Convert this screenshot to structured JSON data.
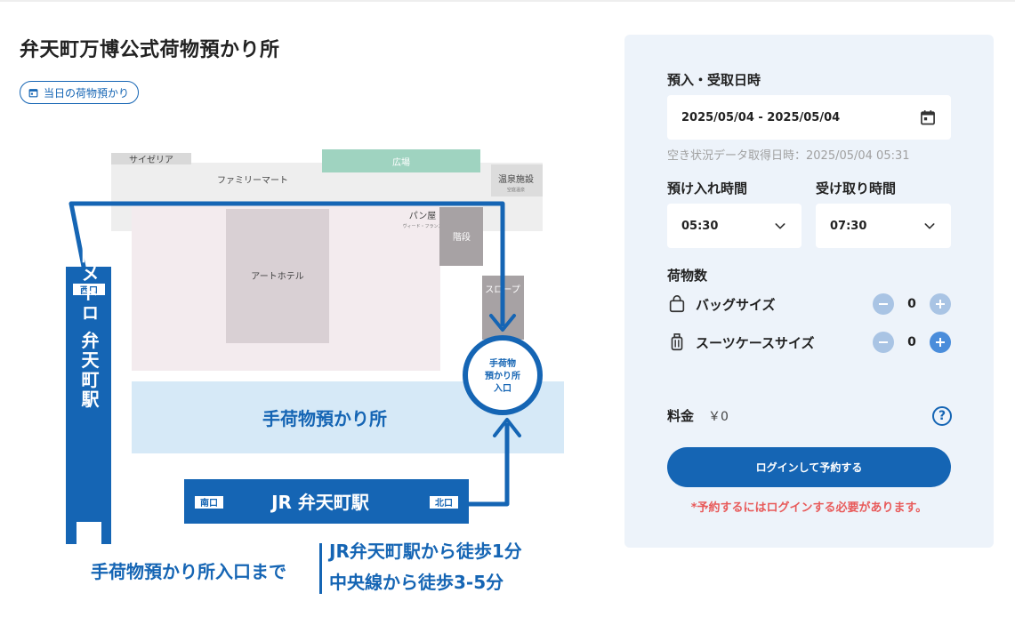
{
  "page": {
    "title": "弁天町万博公式荷物預かり所",
    "tag_label": "当日の荷物預かり"
  },
  "map": {
    "labels": {
      "saizeriya": "サイゼリア",
      "square": "広場",
      "family_mart": "ファミリーマート",
      "onsen": "温泉施設",
      "onsen_sub": "空庭温泉",
      "bakery": "パン屋",
      "bakery_sub": "ヴィード・フランス",
      "stairs": "階段",
      "art_hotel": "アートホテル",
      "slope": "スロープ",
      "west_exit": "西口",
      "metro": "大阪メトロ 弁天町駅",
      "entrance_line1": "手荷物",
      "entrance_line2": "預かり所",
      "entrance_line3": "入口",
      "storage": "手荷物預かり所",
      "south_exit": "南口",
      "jr_station": "JR 弁天町駅",
      "north_exit": "北口",
      "to_entrance": "手荷物預かり所入口まで",
      "walk_jr": "JR弁天町駅から徒歩1分",
      "walk_chuo": "中央線から徒歩3-5分"
    }
  },
  "booking": {
    "datetime_label": "預入・受取日時",
    "date_range": "2025/05/04 - 2025/05/04",
    "availability_note": "空き状況データ取得日時：2025/05/04 05:31",
    "dropoff_label": "預け入れ時間",
    "dropoff_value": "05:30",
    "pickup_label": "受け取り時間",
    "pickup_value": "07:30",
    "count_label": "荷物数",
    "items": [
      {
        "name": "バッグサイズ",
        "qty": "0",
        "icon": "bag-icon"
      },
      {
        "name": "スーツケースサイズ",
        "qty": "0",
        "icon": "suitcase-icon"
      }
    ],
    "fee_label": "料金",
    "fee_value": "￥0",
    "help_symbol": "?",
    "login_button": "ログインして予約する",
    "login_note": "*予約するにはログインする必要があります。"
  },
  "colors": {
    "brand": "#1565b4",
    "panel_bg": "#edf3fa",
    "warning": "#e85a5a",
    "square_green": "#9fd3c0"
  }
}
